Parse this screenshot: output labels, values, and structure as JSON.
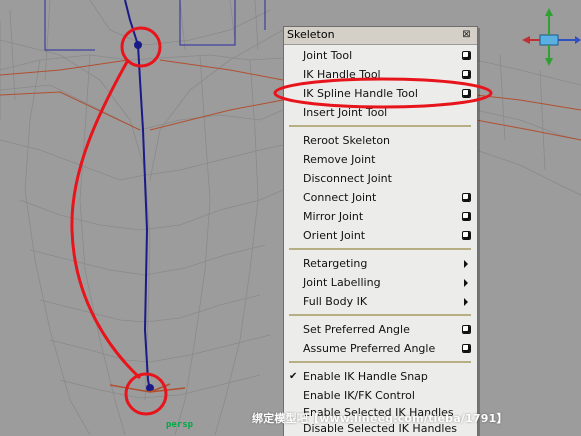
{
  "menu": {
    "title": "Skeleton",
    "close_symbol": "⊠",
    "items": [
      {
        "label": "Joint Tool",
        "option_box": true
      },
      {
        "label": "IK Handle Tool",
        "option_box": true
      },
      {
        "label": "IK Spline Handle Tool",
        "option_box": true,
        "highlighted": true
      },
      {
        "label": "Insert Joint Tool"
      },
      {
        "label": "Reroot Skeleton"
      },
      {
        "label": "Remove Joint"
      },
      {
        "label": "Disconnect Joint"
      },
      {
        "label": "Connect Joint",
        "option_box": true
      },
      {
        "label": "Mirror Joint",
        "option_box": true
      },
      {
        "label": "Orient Joint",
        "option_box": true
      },
      {
        "label": "Retargeting",
        "submenu": true
      },
      {
        "label": "Joint Labelling",
        "submenu": true
      },
      {
        "label": "Full Body IK",
        "submenu": true
      },
      {
        "label": "Set Preferred Angle",
        "option_box": true
      },
      {
        "label": "Assume Preferred Angle",
        "option_box": true
      },
      {
        "label": "Enable IK Handle Snap",
        "checked": true
      },
      {
        "label": "Enable IK/FK Control"
      },
      {
        "label": "Enable Selected IK Handles"
      },
      {
        "label": "Disable Selected IK Handles"
      }
    ]
  },
  "viewport": {
    "camera_label": "persp"
  },
  "watermark": "绑定模型吧【www.lineeg.com/tieba/1791】",
  "colors": {
    "annotation_red": "#e8141c",
    "wireframe": "#8a8a8a",
    "joint_blue": "#1a1a88",
    "highlight_frame": "#b05030"
  }
}
